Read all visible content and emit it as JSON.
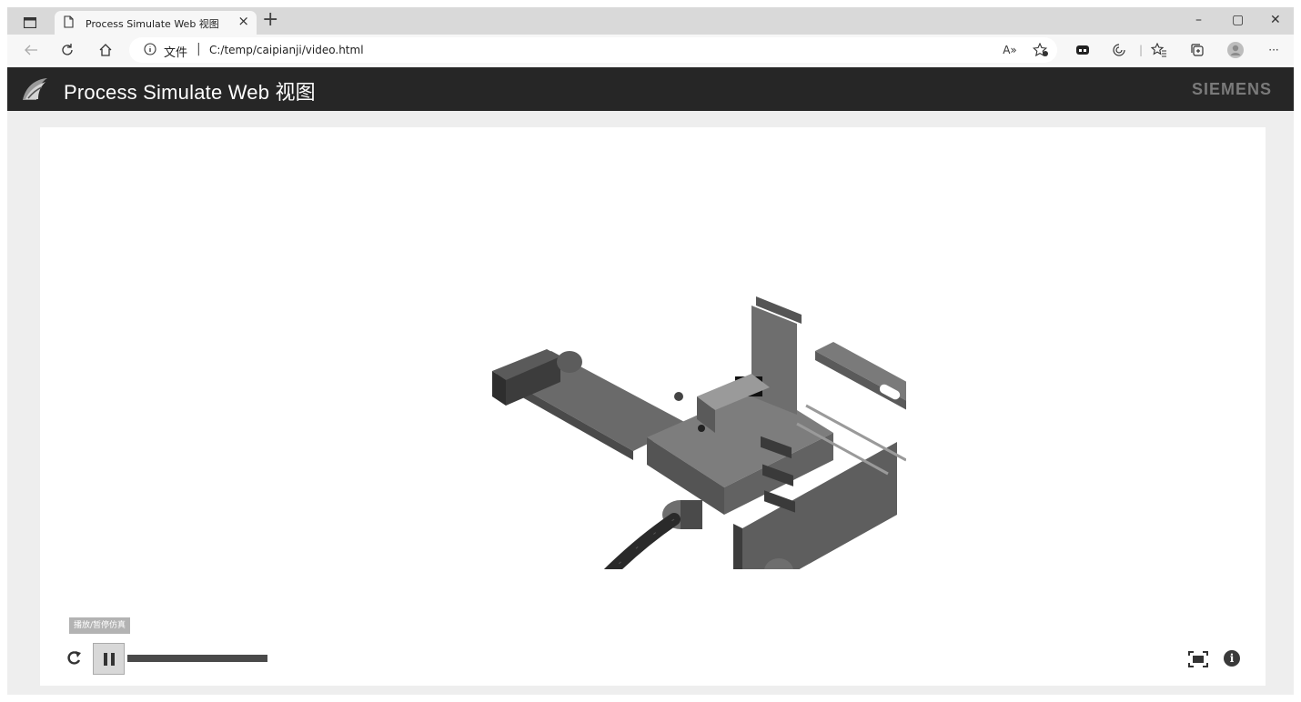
{
  "browser": {
    "tab_title": "Process Simulate Web 视图",
    "tab_close": "×",
    "new_tab": "+",
    "window_controls": {
      "minimize": "–",
      "restore": "▢",
      "close": "✕"
    },
    "address_info_label": "文件",
    "address_separator": "|",
    "url": "C:/temp/caipianji/video.html",
    "toolbar_icons": [
      "back-icon",
      "refresh-icon",
      "home-icon",
      "read-aloud-icon",
      "add-favorite-icon",
      "extension-icon",
      "copilot-icon",
      "favorites-icon",
      "collections-icon",
      "profile-icon",
      "more-icon"
    ],
    "more_label": "···",
    "read_aloud_label": "A»"
  },
  "app": {
    "title": "Process Simulate Web 视图",
    "brand": "SIEMENS"
  },
  "player": {
    "tooltip": "播放/暂停仿真",
    "progress": 1.0,
    "controls": [
      "replay-icon",
      "pause-icon",
      "fit-view-icon",
      "info-icon"
    ],
    "info_glyph": "i"
  },
  "colors": {
    "header_bg": "#262626",
    "brand_text": "#7a7a7a",
    "page_bg": "#eeeeee",
    "viewer_bg": "#ffffff",
    "progress_fill": "#4a4a4a"
  }
}
